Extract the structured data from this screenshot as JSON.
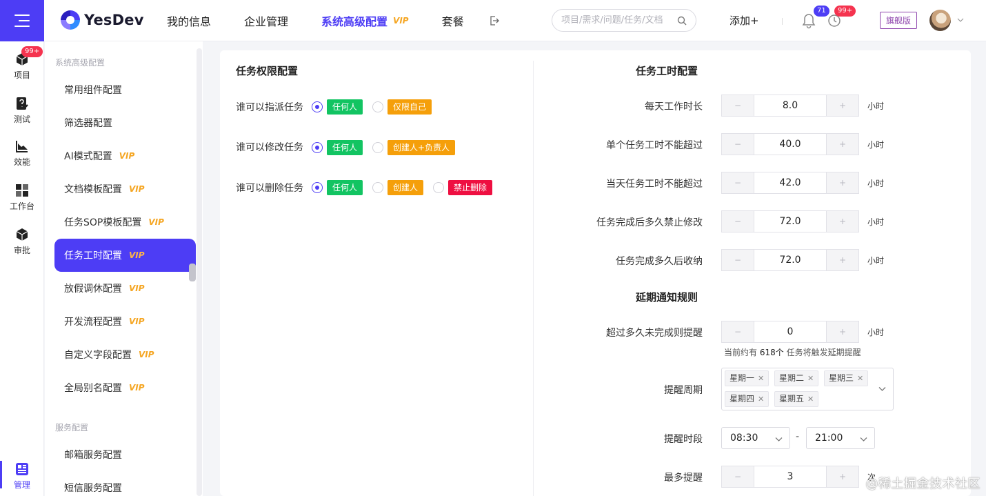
{
  "app": {
    "logo_text": "YesDev"
  },
  "topnav": {
    "items": [
      {
        "label": "我的信息"
      },
      {
        "label": "企业管理"
      },
      {
        "label": "系统高级配置",
        "vip": "VIP"
      },
      {
        "label": "套餐"
      }
    ],
    "search_placeholder": "项目/需求/问题/任务/文档",
    "add_label": "添加+",
    "bell_badge": "71",
    "clock_badge": "99+",
    "plan_label": "旗舰版",
    "icons": [
      "menu-icon",
      "exit-icon",
      "search-icon",
      "bell-icon",
      "clock-icon",
      "chevron-down-icon"
    ]
  },
  "rail": {
    "items": [
      {
        "label": "项目",
        "badge": "99+",
        "icon": "cube-icon"
      },
      {
        "label": "测试",
        "icon": "test-icon"
      },
      {
        "label": "效能",
        "icon": "chart-icon"
      },
      {
        "label": "工作台",
        "icon": "workbench-icon"
      },
      {
        "label": "审批",
        "icon": "approval-icon"
      },
      {
        "label": "管理",
        "icon": "manage-icon",
        "active": true
      }
    ]
  },
  "config_nav": {
    "group1": "系统高级配置",
    "items": [
      {
        "label": "常用组件配置",
        "vip": ""
      },
      {
        "label": "筛选器配置",
        "vip": ""
      },
      {
        "label": "AI模式配置",
        "vip": "VIP"
      },
      {
        "label": "文档模板配置",
        "vip": "VIP"
      },
      {
        "label": "任务SOP模板配置",
        "vip": "VIP"
      },
      {
        "label": "任务工时配置",
        "vip": "VIP",
        "active": true
      },
      {
        "label": "放假调休配置",
        "vip": "VIP"
      },
      {
        "label": "开发流程配置",
        "vip": "VIP"
      },
      {
        "label": "自定义字段配置",
        "vip": "VIP"
      },
      {
        "label": "全局别名配置",
        "vip": "VIP"
      }
    ],
    "group2": "服务配置",
    "items2": [
      {
        "label": "邮箱服务配置"
      },
      {
        "label": "短信服务配置"
      }
    ]
  },
  "permissions": {
    "title": "任务权限配置",
    "rows": [
      {
        "label": "谁可以指派任务",
        "options": [
          {
            "text": "任何人",
            "color": "green",
            "selected": true
          },
          {
            "text": "仅限自己",
            "color": "orange",
            "selected": false
          }
        ]
      },
      {
        "label": "谁可以修改任务",
        "options": [
          {
            "text": "任何人",
            "color": "green",
            "selected": true
          },
          {
            "text": "创建人+负责人",
            "color": "orange",
            "selected": false
          }
        ]
      },
      {
        "label": "谁可以删除任务",
        "options": [
          {
            "text": "任何人",
            "color": "green",
            "selected": true
          },
          {
            "text": "创建人",
            "color": "orange",
            "selected": false
          },
          {
            "text": "禁止删除",
            "color": "red",
            "selected": false
          }
        ]
      }
    ]
  },
  "worktime": {
    "title": "任务工时配置",
    "fields": [
      {
        "label": "每天工作时长",
        "value": "8.0",
        "unit": "小时"
      },
      {
        "label": "单个任务工时不能超过",
        "value": "40.0",
        "unit": "小时"
      },
      {
        "label": "当天任务工时不能超过",
        "value": "42.0",
        "unit": "小时"
      },
      {
        "label": "任务完成后多久禁止修改",
        "value": "72.0",
        "unit": "小时"
      },
      {
        "label": "任务完成多久后收纳",
        "value": "72.0",
        "unit": "小时"
      }
    ],
    "minus": "−",
    "plus": "+"
  },
  "delay": {
    "title": "延期通知规则",
    "remind_after": {
      "label": "超过多久未完成则提醒",
      "value": "0",
      "unit": "小时"
    },
    "hint_prefix": "当前约有",
    "hint_count": "618个",
    "hint_suffix": "任务将触发延期提醒",
    "cycle_label": "提醒周期",
    "days": [
      "星期一",
      "星期二",
      "星期三",
      "星期四",
      "星期五"
    ],
    "period_label": "提醒时段",
    "period_start": "08:30",
    "period_end": "21:00",
    "period_sep": "-",
    "max_label": "最多提醒",
    "max_value": "3",
    "max_unit": "次"
  },
  "watermark": "@稀土掘金技术社区",
  "colors": {
    "primary": "#4d3df5",
    "green": "#12c462",
    "orange": "#f59f0a",
    "red": "#ee0f41",
    "vip": "#f5a623"
  }
}
